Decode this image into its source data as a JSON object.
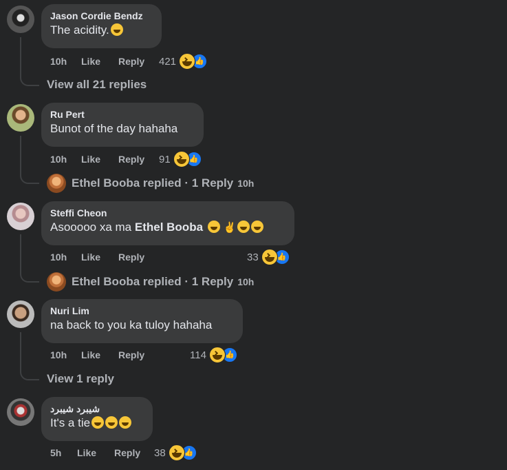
{
  "comments": [
    {
      "author": "Jason Cordie Bendz",
      "text": "The acidity.",
      "time": "10h",
      "like": "Like",
      "reply": "Reply",
      "reactions": "421",
      "view_replies": "View all 21 replies"
    },
    {
      "author": "Ru Pert",
      "text": "Bunot of the day hahaha",
      "time": "10h",
      "like": "Like",
      "reply": "Reply",
      "reactions": "91",
      "replied_by": "Ethel Booba replied · 1 Reply",
      "replied_time": "10h"
    },
    {
      "author": "Steffi Cheon",
      "text_prefix": "Asooooo xa ma ",
      "mention": "Ethel Booba",
      "time": "10h",
      "like": "Like",
      "reply": "Reply",
      "reactions": "33",
      "replied_by": "Ethel Booba replied · 1 Reply",
      "replied_time": "10h"
    },
    {
      "author": "Nuri Lim",
      "text": "na back to you ka tuloy hahaha",
      "time": "10h",
      "like": "Like",
      "reply": "Reply",
      "reactions": "114",
      "view_replies": "View 1 reply"
    },
    {
      "author": "شيبرد شيبرد",
      "text": "It's a tie",
      "time": "5h",
      "like": "Like",
      "reply": "Reply",
      "reactions": "38"
    }
  ],
  "icons": {
    "haha": "haha-reaction-icon",
    "like": "like-reaction-icon",
    "like_color": "#1877f2",
    "haha_color": "#f7c638"
  }
}
